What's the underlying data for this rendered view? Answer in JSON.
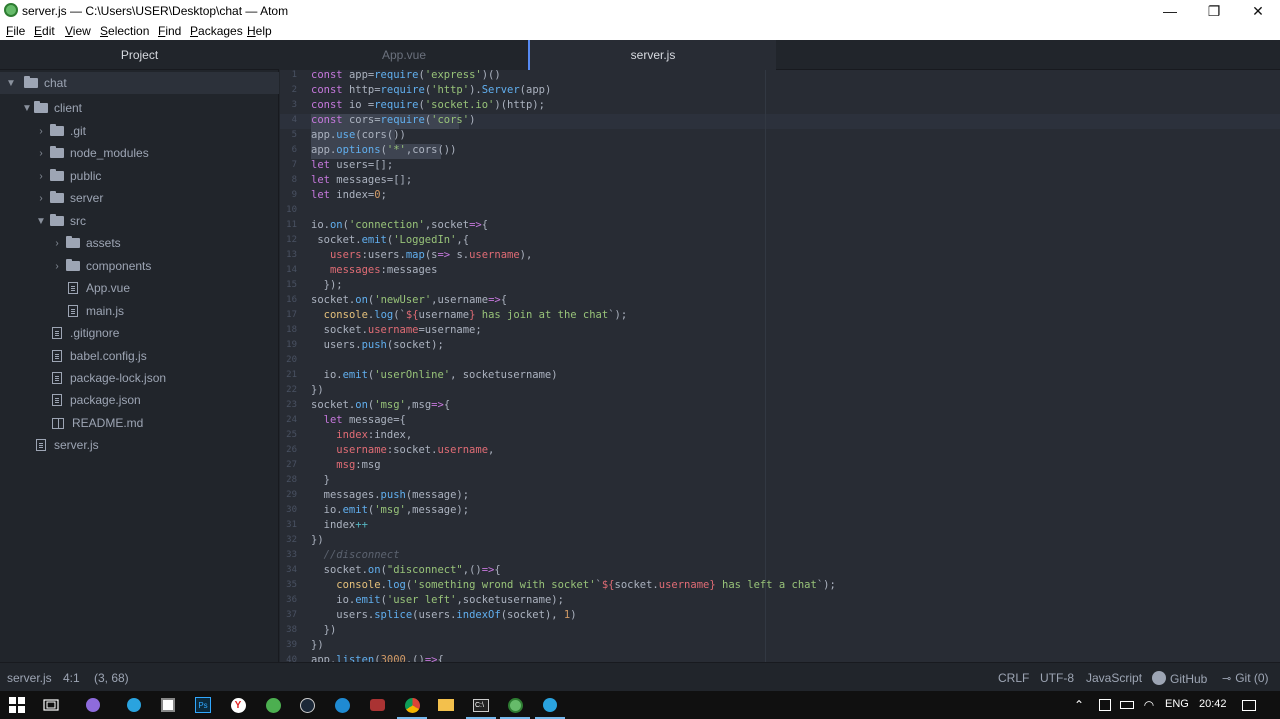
{
  "window": {
    "title": "server.js — C:\\Users\\USER\\Desktop\\chat — Atom",
    "controls": [
      "—",
      "❐",
      "✕"
    ]
  },
  "menu": [
    {
      "label": "File",
      "u": "F",
      "rest": "ile"
    },
    {
      "label": "Edit",
      "u": "E",
      "rest": "dit"
    },
    {
      "label": "View",
      "u": "V",
      "rest": "iew"
    },
    {
      "label": "Selection",
      "u": "S",
      "rest": "election"
    },
    {
      "label": "Find",
      "u": "F",
      "rest": "ind"
    },
    {
      "label": "Packages",
      "u": "P",
      "rest": "ackages"
    },
    {
      "label": "Help",
      "u": "H",
      "rest": "elp"
    }
  ],
  "tree": {
    "header": "Project",
    "items": [
      {
        "label": "chat",
        "kind": "folder",
        "open": true,
        "selected": true
      },
      {
        "label": "client",
        "kind": "folder",
        "open": true
      },
      {
        "label": ".git",
        "kind": "folder"
      },
      {
        "label": "node_modules",
        "kind": "folder"
      },
      {
        "label": "public",
        "kind": "folder"
      },
      {
        "label": "server",
        "kind": "folder"
      },
      {
        "label": "src",
        "kind": "folder",
        "open": true
      },
      {
        "label": "assets",
        "kind": "folder"
      },
      {
        "label": "components",
        "kind": "folder"
      },
      {
        "label": "App.vue",
        "kind": "file"
      },
      {
        "label": "main.js",
        "kind": "file"
      },
      {
        "label": ".gitignore",
        "kind": "file"
      },
      {
        "label": "babel.config.js",
        "kind": "file"
      },
      {
        "label": "package-lock.json",
        "kind": "file"
      },
      {
        "label": "package.json",
        "kind": "file"
      },
      {
        "label": "README.md",
        "kind": "book"
      },
      {
        "label": "server.js",
        "kind": "file"
      }
    ]
  },
  "tabs": [
    {
      "label": "App.vue",
      "active": false
    },
    {
      "label": "server.js",
      "active": true
    }
  ],
  "code": {
    "line_numbers": [
      "1",
      "2",
      "3",
      "4",
      "5",
      "6",
      "7",
      "8",
      "9",
      "10",
      "11",
      "12",
      "13",
      "14",
      "15",
      "16",
      "17",
      "18",
      "19",
      "20",
      "21",
      "22",
      "23",
      "24",
      "25",
      "26",
      "27",
      "28",
      "29",
      "30",
      "31",
      "32",
      "33",
      "34",
      "35",
      "36",
      "37",
      "38",
      "39",
      "40"
    ],
    "lines": [
      [
        [
          "k",
          "const "
        ],
        [
          "",
          "app="
        ],
        [
          "f",
          "require"
        ],
        [
          "",
          "("
        ],
        [
          "s",
          "'express'"
        ],
        [
          "",
          ")()"
        ]
      ],
      [
        [
          "k",
          "const "
        ],
        [
          "",
          "http="
        ],
        [
          "f",
          "require"
        ],
        [
          "",
          "("
        ],
        [
          "s",
          "'http'"
        ],
        [
          "",
          ")."
        ],
        [
          "f",
          "Server"
        ],
        [
          "",
          "(app)"
        ]
      ],
      [
        [
          "k",
          "const "
        ],
        [
          "",
          "io ="
        ],
        [
          "f",
          "require"
        ],
        [
          "",
          "("
        ],
        [
          "s",
          "'socket.io'"
        ],
        [
          "",
          ")(http);"
        ]
      ],
      [
        [
          "k",
          "const "
        ],
        [
          "",
          "cors="
        ],
        [
          "f",
          "require"
        ],
        [
          "",
          "("
        ],
        [
          "s",
          "'cors'"
        ],
        [
          "",
          ")"
        ]
      ],
      [
        [
          "",
          "app."
        ],
        [
          "f",
          "use"
        ],
        [
          "",
          "(cors())"
        ]
      ],
      [
        [
          "",
          "app."
        ],
        [
          "f",
          "options"
        ],
        [
          "",
          "("
        ],
        [
          "s",
          "'*'"
        ],
        [
          "",
          ","
        ],
        [
          "",
          "cors())"
        ]
      ],
      [
        [
          "k",
          "let "
        ],
        [
          "",
          "users=[];"
        ]
      ],
      [
        [
          "k",
          "let "
        ],
        [
          "",
          "messages=[];"
        ]
      ],
      [
        [
          "k",
          "let "
        ],
        [
          "",
          "index="
        ],
        [
          "n",
          "0"
        ],
        [
          "",
          ";"
        ]
      ],
      [
        [
          "",
          ""
        ]
      ],
      [
        [
          "",
          "io."
        ],
        [
          "f",
          "on"
        ],
        [
          "",
          "("
        ],
        [
          "s",
          "'connection'"
        ],
        [
          "",
          ",socket"
        ],
        [
          "k",
          "=>"
        ],
        [
          "",
          "{"
        ]
      ],
      [
        [
          "",
          "",
          " socket."
        ],
        [
          "f",
          "emit"
        ],
        [
          "",
          "("
        ],
        [
          "s",
          "'LoggedIn'"
        ],
        [
          "",
          ",{"
        ]
      ],
      [
        [
          "",
          "   "
        ],
        [
          "v",
          "users"
        ],
        [
          "",
          ":users."
        ],
        [
          "f",
          "map"
        ],
        [
          "",
          "(s"
        ],
        [
          "k",
          "=>"
        ],
        [
          "",
          "",
          " s."
        ],
        [
          "v",
          "username"
        ],
        [
          "",
          "),"
        ]
      ],
      [
        [
          "",
          "   "
        ],
        [
          "v",
          "messages"
        ],
        [
          "",
          ":messages"
        ]
      ],
      [
        [
          "",
          "  });"
        ]
      ],
      [
        [
          "",
          "socket."
        ],
        [
          "f",
          "on"
        ],
        [
          "",
          "("
        ],
        [
          "s",
          "'newUser'"
        ],
        [
          "",
          ",username"
        ],
        [
          "k",
          "=>"
        ],
        [
          "",
          "{"
        ]
      ],
      [
        [
          "",
          "  "
        ],
        [
          "y",
          "console"
        ],
        [
          "",
          "."
        ],
        [
          "f",
          "log"
        ],
        [
          "",
          "(`"
        ],
        [
          "v",
          "${"
        ],
        [
          "",
          "username"
        ],
        [
          "v",
          "}"
        ],
        [
          "s",
          " has join at the chat"
        ],
        [
          "",
          "`);"
        ]
      ],
      [
        [
          "",
          "  socket."
        ],
        [
          "v",
          "username"
        ],
        [
          "",
          "=username;"
        ]
      ],
      [
        [
          "",
          "  users."
        ],
        [
          "f",
          "push"
        ],
        [
          "",
          "(socket);"
        ]
      ],
      [
        [
          "",
          ""
        ]
      ],
      [
        [
          "",
          "  io."
        ],
        [
          "f",
          "emit"
        ],
        [
          "",
          "("
        ],
        [
          "s",
          "'userOnline'"
        ],
        [
          "",
          ", socketusername)"
        ]
      ],
      [
        [
          "",
          "})"
        ]
      ],
      [
        [
          "",
          "socket."
        ],
        [
          "f",
          "on"
        ],
        [
          "",
          "("
        ],
        [
          "s",
          "'msg'"
        ],
        [
          "",
          ",msg"
        ],
        [
          "k",
          "=>"
        ],
        [
          "",
          "{"
        ]
      ],
      [
        [
          "",
          "  "
        ],
        [
          "k",
          "let "
        ],
        [
          "",
          "message={"
        ]
      ],
      [
        [
          "",
          "    "
        ],
        [
          "v",
          "index"
        ],
        [
          "",
          ":index,"
        ]
      ],
      [
        [
          "",
          "    "
        ],
        [
          "v",
          "username"
        ],
        [
          "",
          ":socket."
        ],
        [
          "v",
          "username"
        ],
        [
          "",
          ","
        ]
      ],
      [
        [
          "",
          "    "
        ],
        [
          "v",
          "msg"
        ],
        [
          "",
          ":msg"
        ]
      ],
      [
        [
          "",
          "  }"
        ]
      ],
      [
        [
          "",
          "  messages."
        ],
        [
          "f",
          "push"
        ],
        [
          "",
          "(message);"
        ]
      ],
      [
        [
          "",
          "  io."
        ],
        [
          "f",
          "emit"
        ],
        [
          "",
          "("
        ],
        [
          "s",
          "'msg'"
        ],
        [
          "",
          ",message);"
        ]
      ],
      [
        [
          "",
          "  index"
        ],
        [
          "o",
          "++"
        ]
      ],
      [
        [
          "",
          "})"
        ]
      ],
      [
        [
          "",
          "  "
        ],
        [
          "c",
          "//disconnect"
        ]
      ],
      [
        [
          "",
          "  socket."
        ],
        [
          "f",
          "on"
        ],
        [
          "",
          "("
        ],
        [
          "s",
          "\"disconnect\""
        ],
        [
          "",
          ",()"
        ],
        [
          "k",
          "=>"
        ],
        [
          "",
          "{"
        ]
      ],
      [
        [
          "",
          "    "
        ],
        [
          "y",
          "console"
        ],
        [
          "",
          "."
        ],
        [
          "f",
          "log"
        ],
        [
          "",
          "("
        ],
        [
          "s",
          "'something wrond with socket'"
        ],
        [
          "",
          "`"
        ],
        [
          "v",
          "${"
        ],
        [
          "",
          "socket."
        ],
        [
          "v",
          "username"
        ],
        [
          "v",
          "}"
        ],
        [
          "s",
          " has left a chat"
        ],
        [
          "",
          "`);"
        ]
      ],
      [
        [
          "",
          "    io."
        ],
        [
          "f",
          "emit"
        ],
        [
          "",
          "("
        ],
        [
          "s",
          "'user left'"
        ],
        [
          "",
          ",socketusername);"
        ]
      ],
      [
        [
          "",
          "    users."
        ],
        [
          "f",
          "splice"
        ],
        [
          "",
          "(users."
        ],
        [
          "f",
          "indexOf"
        ],
        [
          "",
          "(socket), "
        ],
        [
          "n",
          "1"
        ],
        [
          "",
          ")"
        ]
      ],
      [
        [
          "",
          "  })"
        ]
      ],
      [
        [
          "",
          "})"
        ]
      ],
      [
        [
          "",
          "app."
        ],
        [
          "f",
          "listen"
        ],
        [
          "",
          "("
        ],
        [
          "n",
          "3000"
        ],
        [
          "",
          ",()"
        ],
        [
          "k",
          "=>"
        ],
        [
          "",
          "{"
        ]
      ]
    ]
  },
  "status": {
    "file": "server.js",
    "cursor": "4:1",
    "selection": "(3, 68)",
    "line_ending": "CRLF",
    "encoding": "UTF-8",
    "grammar": "JavaScript",
    "github": "GitHub",
    "git": "Git (0)"
  },
  "taskbar": {
    "lang": "ENG",
    "time": "20:42",
    "icons": [
      "windows-start-icon",
      "task-view-icon",
      "ai-assistant-icon",
      "telegram-icon",
      "sticky-notes-icon",
      "photoshop-icon",
      "yandex-browser-icon",
      "atom-green-icon",
      "steam-icon",
      "edge-icon",
      "game-icon",
      "chrome-icon",
      "file-explorer-icon",
      "terminal-icon",
      "atom-icon",
      "telegram-2-icon"
    ]
  }
}
